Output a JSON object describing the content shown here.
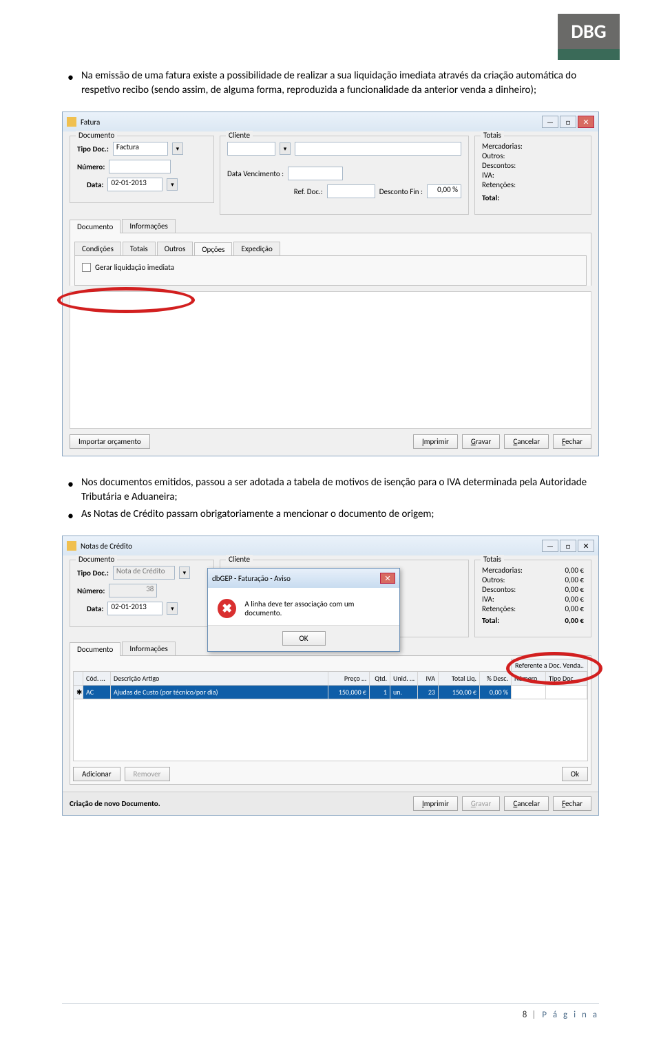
{
  "logo": "DBG",
  "para1": "Na emissão de uma fatura existe a possibilidade de realizar a sua liquidação imediata através da criação automática do respetivo recibo (sendo assim, de alguma forma, reproduzida a funcionalidade da anterior venda a dinheiro);",
  "win1": {
    "title": "Fatura",
    "fs_doc": "Documento",
    "fs_cli": "Cliente",
    "fs_tot": "Totais",
    "tipodoc_lbl": "Tipo Doc.:",
    "tipodoc_val": "Factura",
    "numero_lbl": "Número:",
    "data_lbl": "Data:",
    "data_val": "02-01-2013",
    "datavenc_lbl": "Data Vencimento :",
    "refdoc_lbl": "Ref. Doc.:",
    "descfin_lbl": "Desconto Fin :",
    "descfin_val": "0,00 %",
    "totals": {
      "merc": "Mercadorias:",
      "out": "Outros:",
      "desc": "Descontos:",
      "iva": "IVA:",
      "ret": "Retenções:",
      "total": "Total:"
    },
    "tabrow_top": [
      "Documento",
      "Informações"
    ],
    "tabrow_sub": [
      "Condições",
      "Totais",
      "Outros",
      "Opções",
      "Expedição"
    ],
    "checkbox_lbl": "Gerar liquidação imediata",
    "btn_import": "Importar orçamento",
    "btn_imprimir": "Imprimir",
    "btn_gravar": "Gravar",
    "btn_cancelar": "Cancelar",
    "btn_fechar": "Fechar"
  },
  "para2_a": "Nos documentos emitidos, passou a ser adotada a tabela de motivos de isenção para o IVA determinada pela Autoridade Tributária e Aduaneira;",
  "para2_b": "As Notas de Crédito passam obrigatoriamente a mencionar o documento de origem;",
  "win2": {
    "title": "Notas de Crédito",
    "fs_doc": "Documento",
    "fs_cli": "Cliente",
    "fs_tot": "Totais",
    "tipodoc_val": "Nota de Crédito",
    "numero_val": "38",
    "data_val": "02-01-2013",
    "totals": {
      "merc": "Mercadorias:",
      "merc_v": "0,00 €",
      "out": "Outros:",
      "out_v": "0,00 €",
      "desc": "Descontos:",
      "desc_v": "0,00 €",
      "iva": "IVA:",
      "iva_v": "0,00 €",
      "ret": "Retenções:",
      "ret_v": "0,00 €",
      "total": "Total:",
      "total_v": "0,00 €"
    },
    "tabs": [
      "Documento",
      "Informações"
    ],
    "msg_title": "dbGEP - Faturação - Aviso",
    "msg_text": "A linha deve ter associação com um documento.",
    "msg_ok": "OK",
    "ref_header": "Referente a Doc. Venda..",
    "grid_headers": {
      "cod": "Cód. …",
      "desc": "Descrição Artigo",
      "preco": "Preço …",
      "qtd": "Qtd.",
      "unid": "Unid. …",
      "iva": "IVA",
      "liq": "Total Liq.",
      "pdesc": "% Desc.",
      "num": "Número",
      "tdoc": "Tipo Doc."
    },
    "grid_row": {
      "cod": "AC",
      "desc": "Ajudas de Custo (por técnico/por dia)",
      "preco": "150,000 €",
      "qtd": "1",
      "unid": "un.",
      "iva": "23",
      "liq": "150,00 €",
      "pdesc": "0,00 %",
      "num": "",
      "tdoc": ""
    },
    "btn_add": "Adicionar",
    "btn_rem": "Remover",
    "btn_ok": "Ok",
    "status": "Criação de novo Documento.",
    "btn_imprimir": "Imprimir",
    "btn_gravar": "Gravar",
    "btn_cancelar": "Cancelar",
    "btn_fechar": "Fechar"
  },
  "footer_num": "8",
  "footer_txt": "P á g i n a"
}
